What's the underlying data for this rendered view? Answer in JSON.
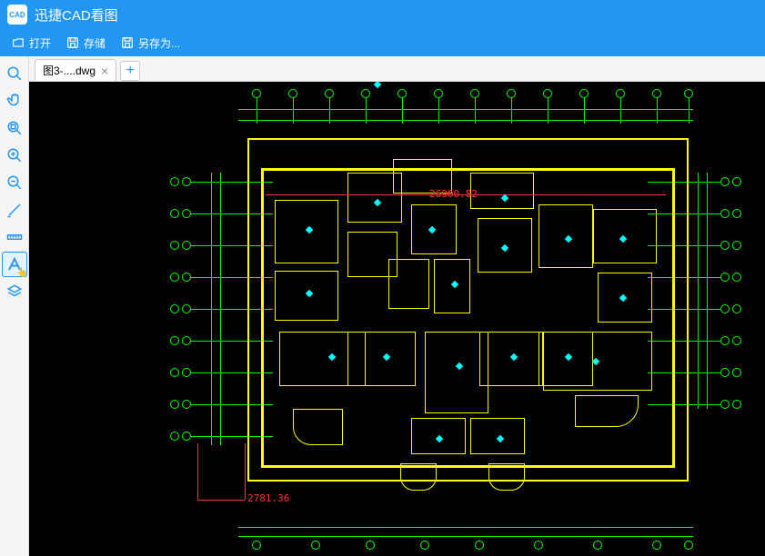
{
  "app": {
    "title": "迅捷CAD看图",
    "logo_text": "CAD"
  },
  "menu": {
    "open": "打开",
    "save": "存储",
    "save_as": "另存为..."
  },
  "tabs": [
    {
      "label": "图3-....dwg"
    }
  ],
  "toolbar": {
    "tools": [
      {
        "name": "zoom-fit",
        "icon": "search"
      },
      {
        "name": "pan",
        "icon": "hand"
      },
      {
        "name": "zoom-window",
        "icon": "zoom-window"
      },
      {
        "name": "zoom-in",
        "icon": "zoom-in"
      },
      {
        "name": "zoom-out",
        "icon": "zoom-out"
      },
      {
        "name": "measure-line",
        "icon": "pencil"
      },
      {
        "name": "measure-dist",
        "icon": "ruler"
      },
      {
        "name": "text-tool",
        "icon": "text",
        "active": true
      },
      {
        "name": "layers",
        "icon": "layers"
      }
    ]
  },
  "drawing": {
    "dim1": "26900.82",
    "dim2": "2781.36"
  }
}
